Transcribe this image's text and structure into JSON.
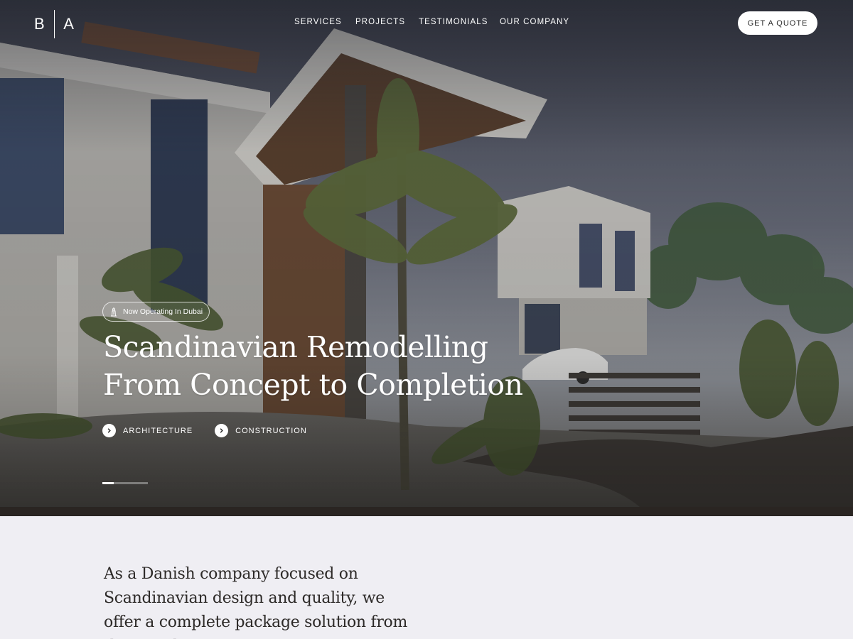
{
  "header": {
    "logo_left": "B",
    "logo_right": "A",
    "nav": [
      "SERVICES",
      "PROJECTS",
      "TESTIMONIALS",
      "OUR COMPANY"
    ],
    "cta_label": "GET A QUOTE"
  },
  "hero": {
    "badge_icon": "tower-icon",
    "badge_text": "Now Operating In Dubai",
    "headline_line1": "Scandinavian Remodelling",
    "headline_line2": "From Concept to Completion",
    "tags": [
      "ARCHITECTURE",
      "CONSTRUCTION"
    ],
    "slide_progress": 0.25
  },
  "intro": {
    "text": "As a Danish company focused on Scandinavian design and quality, we offer a complete package solution from the initial"
  }
}
